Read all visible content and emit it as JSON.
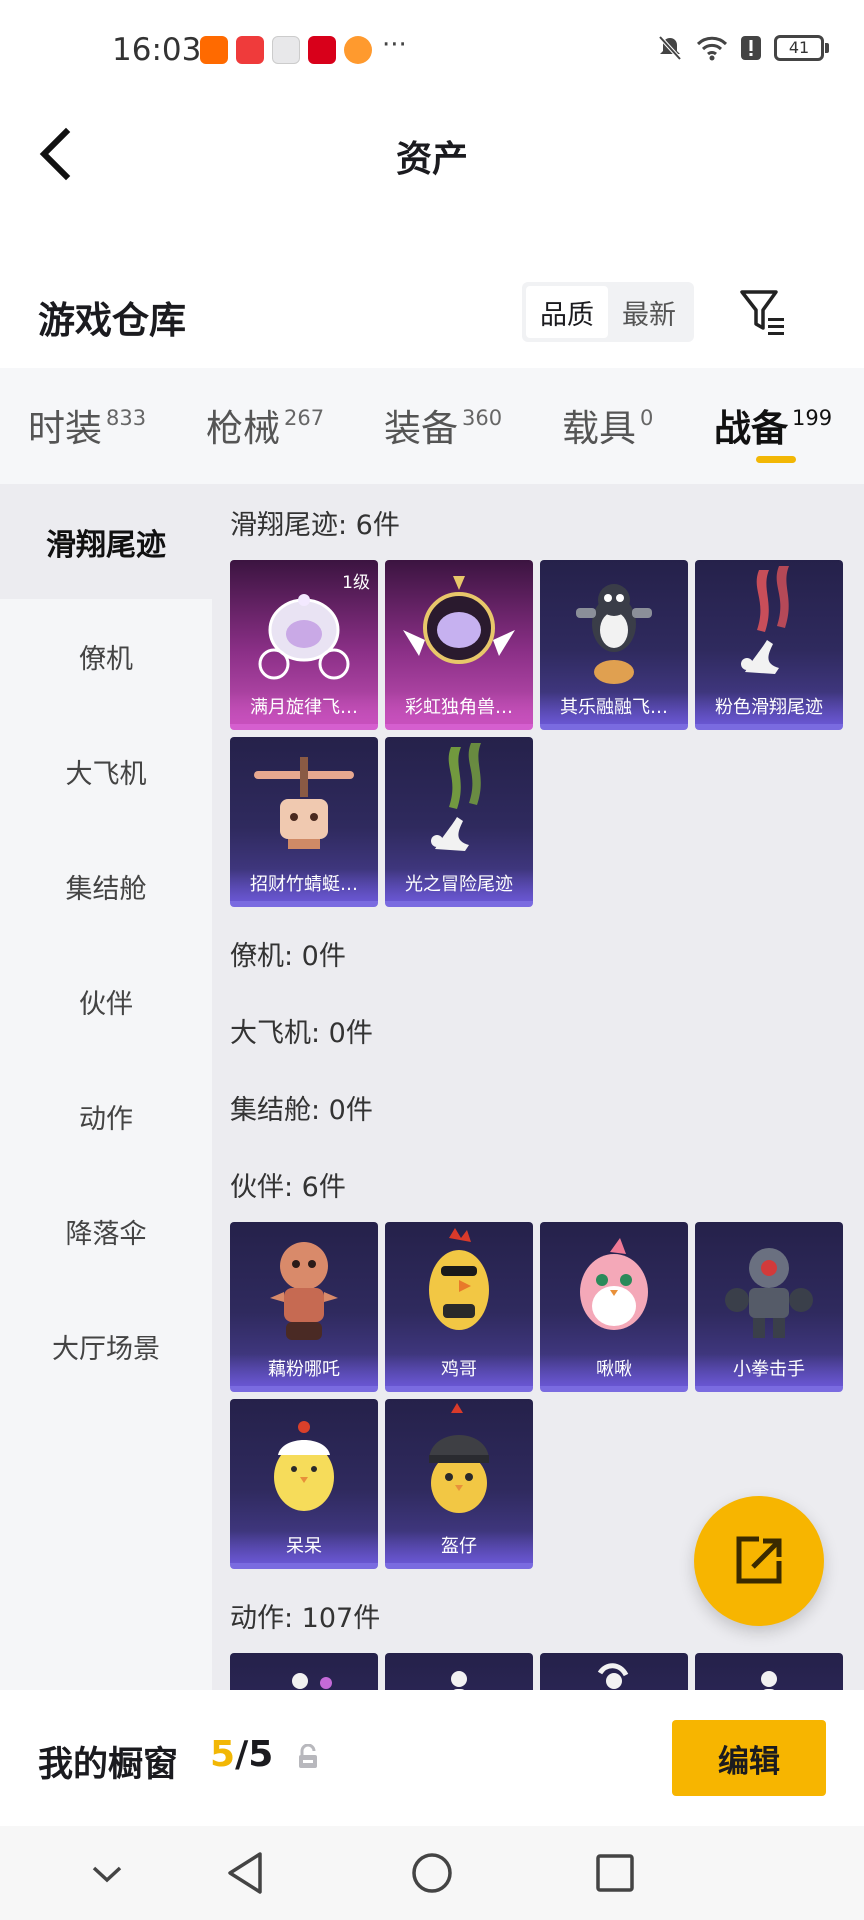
{
  "status_bar": {
    "time": "16:03",
    "more_dots": "···",
    "battery": "41"
  },
  "header": {
    "title": "资产"
  },
  "warehouse": {
    "title": "游戏仓库",
    "sort_options": [
      "品质",
      "最新"
    ],
    "active_sort": "品质"
  },
  "tabs": [
    {
      "label": "时装",
      "count": "833"
    },
    {
      "label": "枪械",
      "count": "267"
    },
    {
      "label": "装备",
      "count": "360"
    },
    {
      "label": "载具",
      "count": "0"
    },
    {
      "label": "战备",
      "count": "199"
    }
  ],
  "active_tab": "战备",
  "sidebar": [
    "滑翔尾迹",
    "僚机",
    "大飞机",
    "集结舱",
    "伙伴",
    "动作",
    "降落伞",
    "大厅场景"
  ],
  "active_sidebar": "滑翔尾迹",
  "sections": {
    "glide_trail": {
      "title": "滑翔尾迹: 6件",
      "items": [
        {
          "name": "满月旋律飞…",
          "level": "1级",
          "rarity": "pink",
          "icon": "carriage"
        },
        {
          "name": "彩虹独角兽…",
          "rarity": "pink",
          "icon": "unicorn-ornament"
        },
        {
          "name": "其乐融融飞…",
          "rarity": "purple",
          "icon": "penguin"
        },
        {
          "name": "粉色滑翔尾迹",
          "rarity": "purple",
          "icon": "pink-smoke"
        },
        {
          "name": "招财竹蜻蜓…",
          "rarity": "purple",
          "icon": "bamboo-copter"
        },
        {
          "name": "光之冒险尾迹",
          "rarity": "purple",
          "icon": "green-smoke"
        }
      ]
    },
    "wingman": {
      "title": "僚机: 0件"
    },
    "big_plane": {
      "title": "大飞机: 0件"
    },
    "pod": {
      "title": "集结舱: 0件"
    },
    "partner": {
      "title": "伙伴: 6件",
      "items": [
        {
          "name": "藕粉哪吒",
          "icon": "nezha"
        },
        {
          "name": "鸡哥",
          "icon": "rooster"
        },
        {
          "name": "啾啾",
          "icon": "pink-bird"
        },
        {
          "name": "小拳击手",
          "icon": "boxer-robot"
        },
        {
          "name": "呆呆",
          "icon": "yellow-chick"
        },
        {
          "name": "盔仔",
          "icon": "helmet-chick"
        }
      ]
    },
    "emote": {
      "title": "动作: 107件"
    }
  },
  "showcase": {
    "label": "我的橱窗",
    "current": "5",
    "separator": "/",
    "total": "5",
    "edit_label": "编辑"
  },
  "colors": {
    "accent": "#f7b500",
    "card_purple": "#2f2a5e",
    "card_pink": "#8a2f86"
  }
}
